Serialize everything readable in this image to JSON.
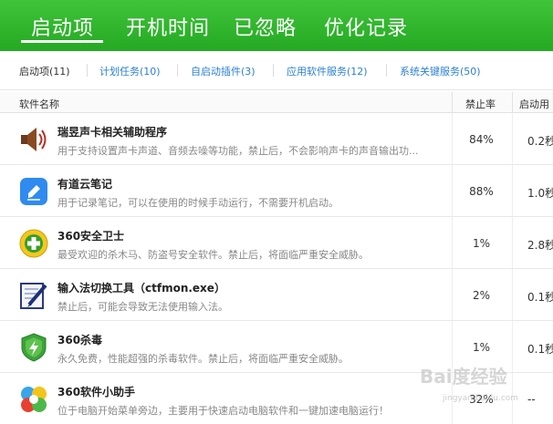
{
  "top_tabs": [
    "启动项",
    "开机时间",
    "已忽略",
    "优化记录"
  ],
  "sub_tabs": [
    "启动项(11)",
    "计划任务(10)",
    "自启动插件(3)",
    "应用软件服务(12)",
    "系统关键服务(50)"
  ],
  "columns": {
    "name": "软件名称",
    "rate": "禁止率",
    "time": "启动用"
  },
  "rows": [
    {
      "icon": "speaker-icon",
      "name": "瑞昱声卡相关辅助程序",
      "desc": "用于支持设置声卡声道、音频去噪等功能，禁止后，不会影响声卡的声音输出功...",
      "rate": "84%",
      "time": "0.2秒"
    },
    {
      "icon": "youdao-note-icon",
      "name": "有道云笔记",
      "desc": "用于记录笔记，可以在使用的时候手动运行，不需要开机启动。",
      "rate": "88%",
      "time": "1.0秒"
    },
    {
      "icon": "360-safe-icon",
      "name": "360安全卫士",
      "desc": "最受欢迎的杀木马、防盗号安全软件。禁止后，将面临严重安全威胁。",
      "rate": "1%",
      "time": "2.8秒"
    },
    {
      "icon": "ime-switch-icon",
      "name": "输入法切换工具（ctfmon.exe）",
      "desc": "禁止后，可能会导致无法使用输入法。",
      "rate": "2%",
      "time": "0.1秒"
    },
    {
      "icon": "360-antivirus-icon",
      "name": "360杀毒",
      "desc": "永久免费，性能超强的杀毒软件。禁止后，将面临严重安全威胁。",
      "rate": "1%",
      "time": "0.1秒"
    },
    {
      "icon": "360-helper-icon",
      "name": "360软件小助手",
      "desc": "位于电脑开始菜单旁边，主要用于快速启动电脑软件和一键加速电脑运行！",
      "rate": "32%",
      "time": "--"
    }
  ],
  "watermark": {
    "main": "Bai度经验",
    "sub": "jingyan.baidu.com"
  },
  "colors": {
    "header_green": "#2fb52c",
    "link_blue": "#2a7fd4"
  }
}
